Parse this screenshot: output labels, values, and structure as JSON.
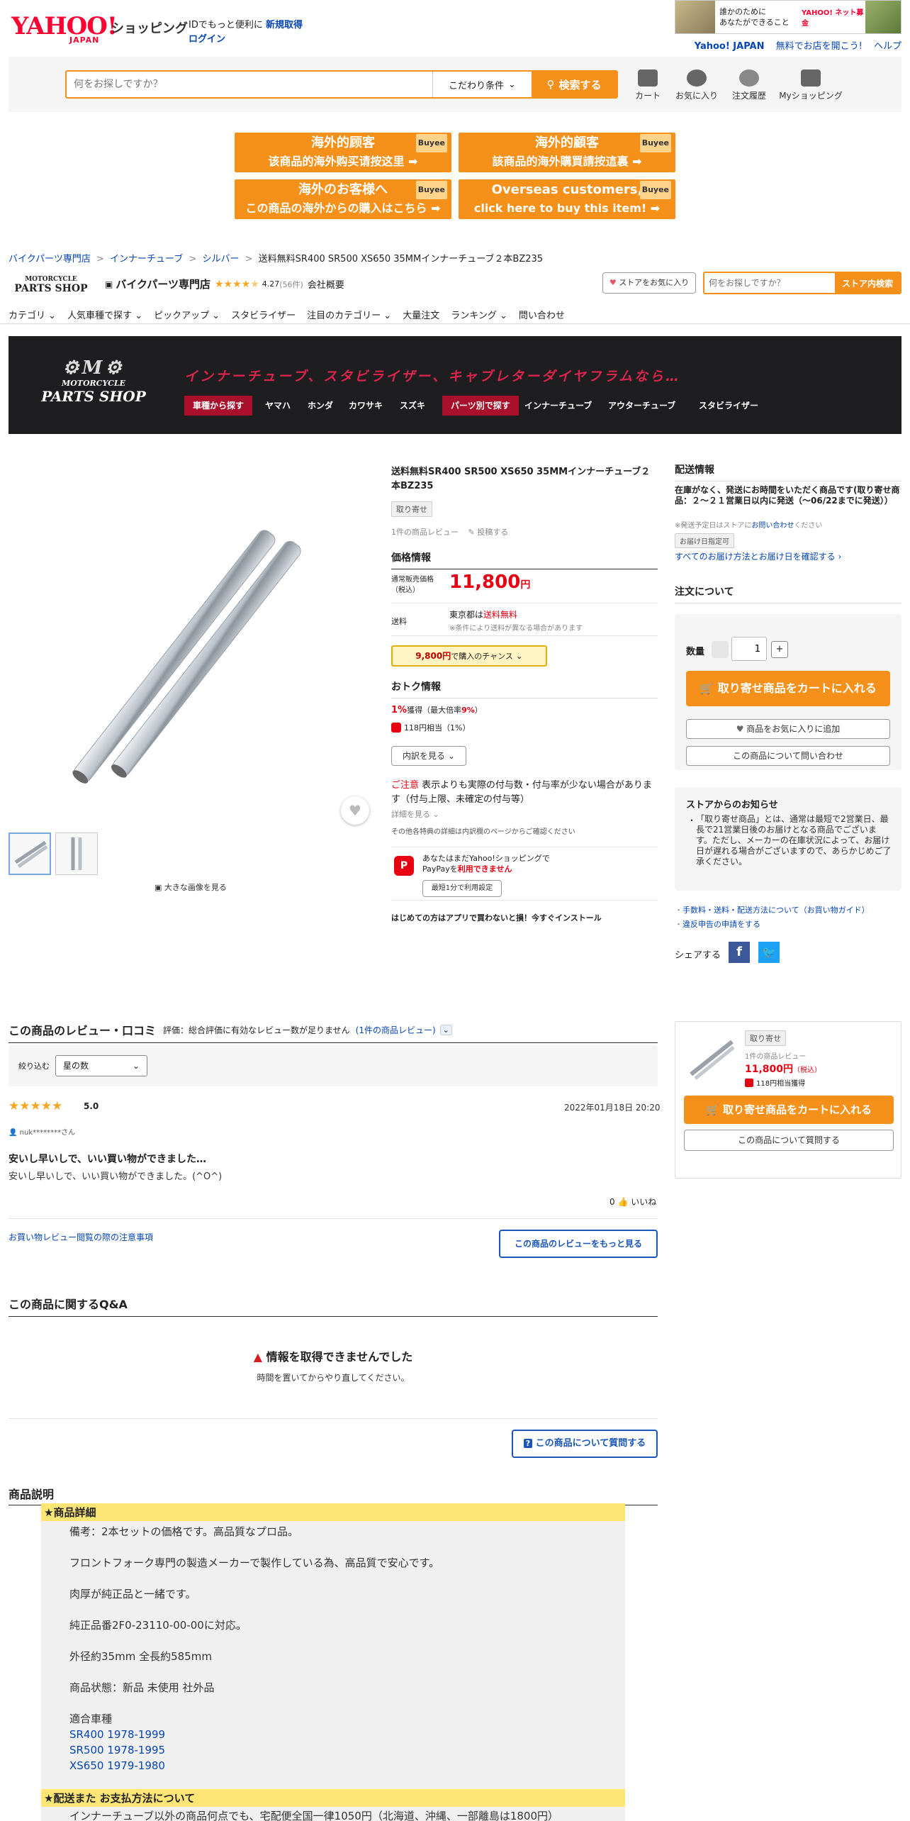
{
  "header": {
    "logo_main": "YAHOO!",
    "logo_sub": "JAPAN",
    "logo_shop": "ショッピング",
    "id_promo": "IDでもっと便利に",
    "signup": "新規取得",
    "login": "ログイン",
    "ad_text1": "誰かのために",
    "ad_text2": "あなたができること",
    "ad_brand": "YAHOO! ネット募金",
    "yahoo_japan_link": "Yahoo! JAPAN",
    "open_store_link": "無料でお店を開こう!",
    "help_link": "ヘルプ"
  },
  "search": {
    "placeholder": "何をお探しですか？",
    "filter_label": "こだわり条件",
    "button_label": "検索する"
  },
  "header_icons": [
    {
      "label": "カート",
      "icon": "cart-icon"
    },
    {
      "label": "お気に入り",
      "icon": "heart-icon"
    },
    {
      "label": "注文履歴",
      "icon": "history-icon"
    },
    {
      "label": "Myショッピング",
      "icon": "user-icon"
    }
  ],
  "buyee": [
    {
      "line1": "海外的顾客",
      "line2": "该商品的海外购买请按这里 ➡",
      "tag": "Buyee"
    },
    {
      "line1": "海外的顧客",
      "line2": "該商品的海外購買請按這裏 ➡",
      "tag": "Buyee"
    },
    {
      "line1": "海外のお客様へ",
      "line2": "この商品の海外からの購入はこちら ➡",
      "tag": "Buyee"
    },
    {
      "line1": "Overseas customers,",
      "line2": "click here to buy this item! ➡",
      "tag": "Buyee"
    }
  ],
  "breadcrumb": {
    "items": [
      "バイクパーツ専門店",
      "インナーチューブ",
      "シルバー"
    ],
    "current": "送料無料SR400 SR500 XS650 35MMインナーチューブ２本BZ235",
    "separator": ">"
  },
  "store": {
    "logo_line1": "MOTORCYCLE",
    "logo_line2": "PARTS SHOP",
    "name": "バイクパーツ専門店",
    "rating": "4.27",
    "rating_count": "(56件)",
    "overview": "会社概要",
    "fav_button": "ストアをお気に入り",
    "search_placeholder": "何をお探しですか？",
    "search_button": "ストア内検索"
  },
  "store_nav": [
    "カテゴリ",
    "人気車種で探す",
    "ピックアップ",
    "スタビライザー",
    "注目のカテゴリー",
    "大量注文",
    "ランキング",
    "問い合わせ"
  ],
  "banner": {
    "logo_line1": "MOTORCYCLE",
    "logo_line2": "PARTS SHOP",
    "tagline": "インナーチューブ、スタビライザー、キャブレターダイヤフラムなら…",
    "tabs": [
      "車種から探す",
      "ヤマハ",
      "ホンダ",
      "カワサキ",
      "スズキ",
      "パーツ別で探す",
      "インナーチューブ",
      "アウターチューブ",
      "スタビライザー"
    ]
  },
  "product": {
    "title": "送料無料SR400 SR500 XS650 35MMインナーチューブ２本BZ235",
    "tag": "取り寄せ",
    "review_count": "1件の商品レビュー",
    "post_link": "投稿する",
    "price_section": "価格情報",
    "price_label": "通常販売価格（税込）",
    "price": "11,800",
    "price_unit": "円",
    "shipping_label": "送料",
    "shipping_region": "東京都は",
    "shipping_free": "送料無料",
    "shipping_note": "※条件により送料が異なる場合があります",
    "chance_price": "9,800円",
    "chance_text": "で購入のチャンス",
    "deals_title": "おトク情報",
    "point_rate": "1%",
    "point_text": "獲得（最大倍率",
    "point_max": "9%",
    "paypay_point": "118円相当（1%）",
    "breakdown_button": "内訳を見る",
    "caution_label": "ご注意",
    "caution_text": "表示よりも実際の付与数・付与率が少ない場合があります（付与上限、未確定の付与等）",
    "detail_link": "詳細を見る",
    "other_note": "その他各特典の詳細は内訳欄のページからご確認ください",
    "paypay_msg1": "あなたはまだYahoo!ショッピングで",
    "paypay_msg2": "PayPayを",
    "paypay_msg3": "利用できません",
    "paypay_setup": "最短1分で利用設定",
    "app_promo": "はじめての方はアプリで買わないと損！今すぐインストール",
    "zoom_link": "大きな画像を見る"
  },
  "delivery": {
    "title": "配送情報",
    "text": "在庫がなく、発送にお時間をいただく商品です(取り寄せ商品：２～２１営業日以内に発送（〜06/22までに発送））",
    "note": "※発送予定日はストアに",
    "note_link": "お問い合わせ",
    "note_end": "ください",
    "date_tag": "お届け日指定可",
    "method_link": "すべてのお届け方法とお届け日を確認する"
  },
  "order": {
    "title": "注文について",
    "qty_label": "数量",
    "qty_value": "1",
    "cart_button": "取り寄せ商品をカートに入れる",
    "fav_button": "商品をお気に入りに追加",
    "inquiry_button": "この商品について問い合わせ"
  },
  "store_notice": {
    "title": "ストアからのお知らせ",
    "text": "「取り寄せ商品」とは、通常は最短で2営業日、最長で21営業日後のお届けとなる商品でございます。ただし、メーカーの在庫状況によって、お届け日が遅れる場合がございますので、あらかじめご了承ください。"
  },
  "guide_links": [
    "手数料・送料・配送方法について（お買い物ガイド）",
    "違反申告の申請をする"
  ],
  "share_label": "シェアする",
  "reviews": {
    "title": "この商品のレビュー・口コミ",
    "summary": "評価：総合評価に有効なレビュー数が足りません",
    "count_link": "(1件の商品レビュー)",
    "filter_label": "絞り込む",
    "filter_select": "星の数",
    "score": "5.0",
    "date": "2022年01月18日 20:20",
    "user": "nuk********さん",
    "review_title": "安いし早いしで、いい買い物ができました…",
    "review_body": "安いし早いしで、いい買い物ができました。(^O^)",
    "likes": "0",
    "like_label": "いいね",
    "notice_link": "お買い物レビュー閲覧の際の注意事項",
    "more_button": "この商品のレビューをもっと見る"
  },
  "qa": {
    "title": "この商品に関するQ&A",
    "error_title": "情報を取得できませんでした",
    "error_sub": "時間を置いてからやり直してください。",
    "ask_button": "この商品について質問する"
  },
  "sticky": {
    "tag": "取り寄せ",
    "reviews": "1件の商品レビュー",
    "price": "11,800円",
    "tax": "（税込）",
    "points": "118円相当獲得",
    "cart_button": "取り寄せ商品をカートに入れる",
    "ask_button": "この商品について質問する"
  },
  "description": {
    "title": "商品説明",
    "section1": "★商品詳細",
    "lines": [
      "備考：2本セットの価格です。高品質なプロ品。",
      "フロントフォーク専門の製造メーカーで製作している為、高品質で安心です。",
      "肉厚が純正品と一緒です。",
      "純正品番2F0-23110-00-00に対応。",
      "外径約35mm 全長約585mm",
      "商品状態：新品 未使用 社外品",
      "適合車種"
    ],
    "models": [
      "SR400 1978-1999",
      "SR500 1978-1995",
      "XS650 1979-1980"
    ],
    "section2": "★配送また お支払方法について",
    "shipping_text": "インナーチューブ以外の商品何点でも、宅配便全国一律1050円（北海道、沖縄、一部離島は1800円）"
  }
}
